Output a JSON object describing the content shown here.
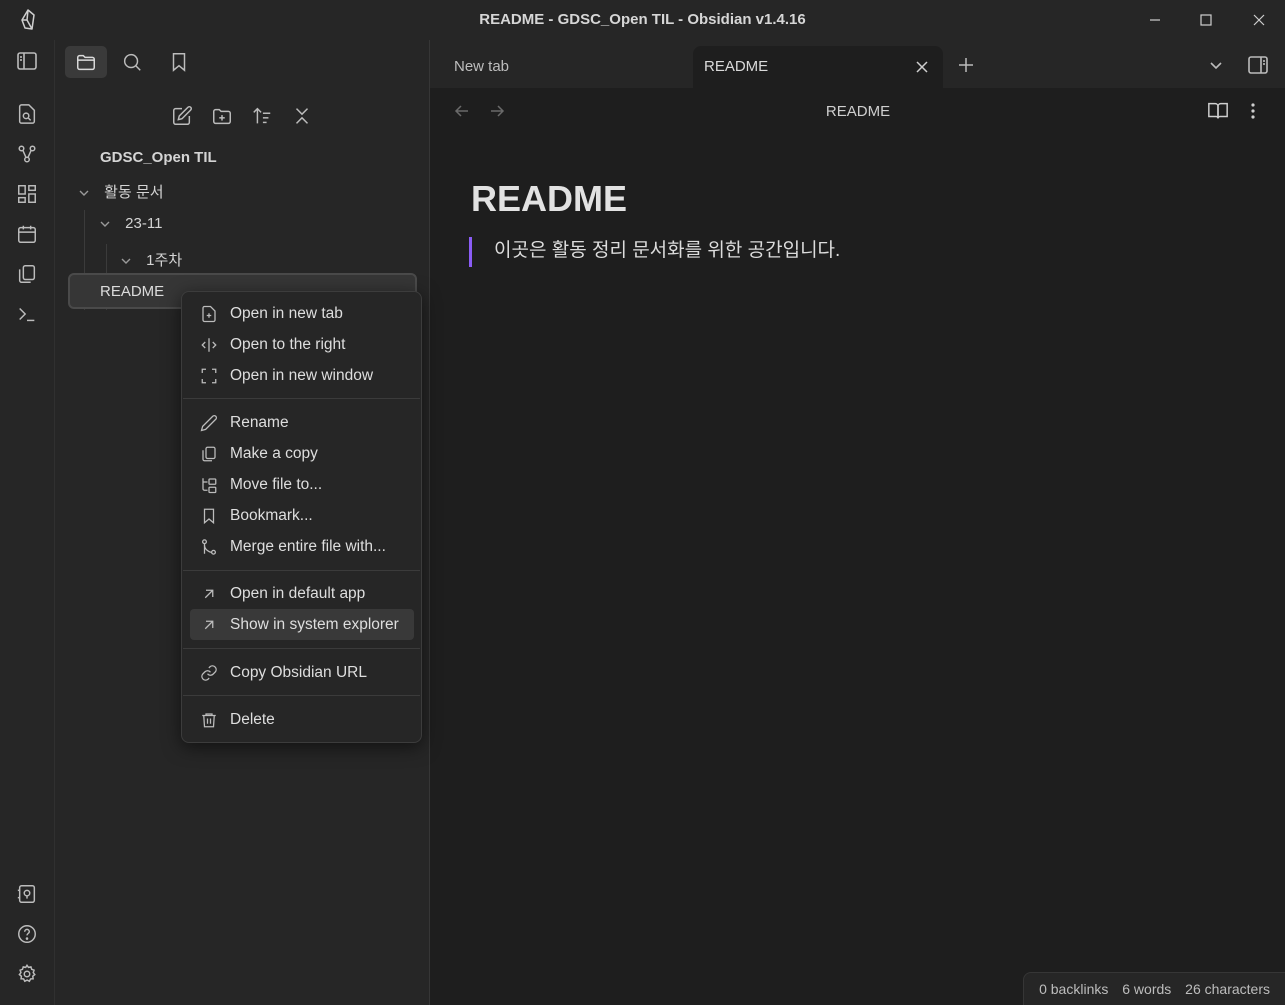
{
  "window": {
    "title": "README - GDSC_Open TIL - Obsidian v1.4.16"
  },
  "sidebar": {
    "vault_name": "GDSC_Open TIL",
    "tree": {
      "folder1": "활동 문서",
      "folder2": "23-11",
      "folder3": "1주차",
      "file": "README"
    }
  },
  "tabs": {
    "tab1": "New tab",
    "tab2": "README"
  },
  "editor": {
    "view_title": "README",
    "heading": "README",
    "quote": "이곳은 활동 정리 문서화를 위한 공간입니다."
  },
  "status": {
    "backlinks": "0 backlinks",
    "words": "6 words",
    "characters": "26 characters"
  },
  "context_menu": {
    "open_new_tab": "Open in new tab",
    "open_right": "Open to the right",
    "open_new_window": "Open in new window",
    "rename": "Rename",
    "make_copy": "Make a copy",
    "move_file": "Move file to...",
    "bookmark": "Bookmark...",
    "merge": "Merge entire file with...",
    "open_default": "Open in default app",
    "show_explorer": "Show in system explorer",
    "copy_url": "Copy Obsidian URL",
    "delete": "Delete"
  },
  "colors": {
    "accent": "#8a5cf5",
    "background": "#1e1e1e",
    "panel": "#262626"
  }
}
